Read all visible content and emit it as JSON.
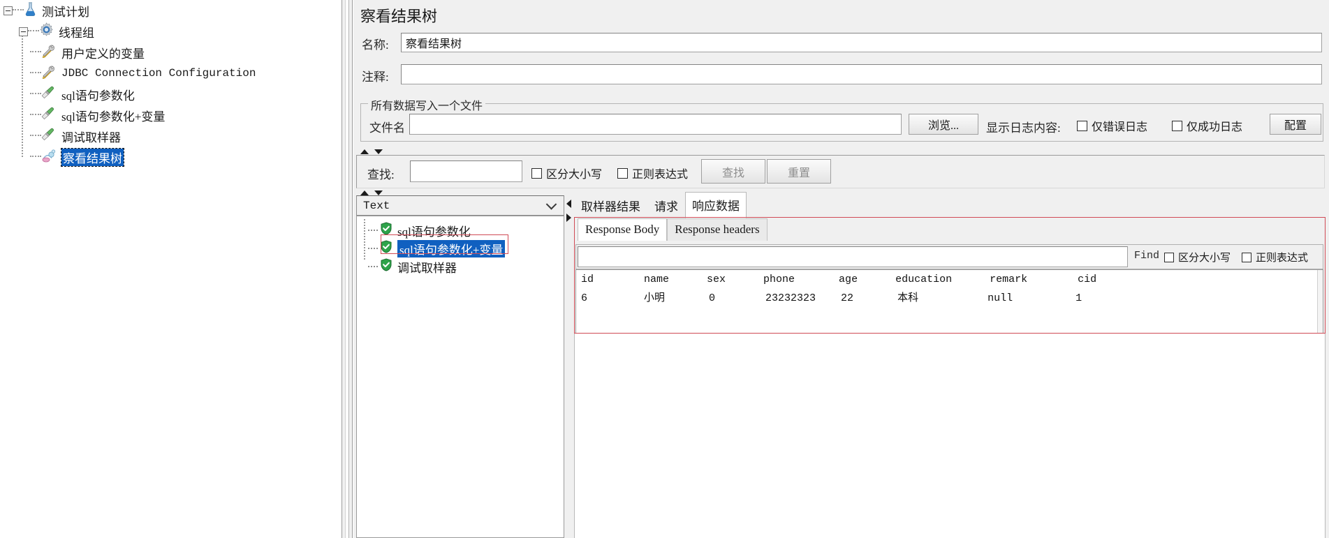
{
  "tree": {
    "items": [
      {
        "label": "测试计划",
        "icon": "flask-icon",
        "depth": 0,
        "selected": false,
        "expander": true
      },
      {
        "label": "线程组",
        "icon": "gear-icon",
        "depth": 1,
        "selected": false,
        "expander": true
      },
      {
        "label": "用户定义的变量",
        "icon": "wrench-screwdriver-icon",
        "depth": 2,
        "selected": false,
        "expander": false
      },
      {
        "label": "JDBC Connection Configuration",
        "icon": "wrench-screwdriver-icon",
        "depth": 2,
        "selected": false,
        "expander": false
      },
      {
        "label": "sql语句参数化",
        "icon": "screwdriver-icon",
        "depth": 2,
        "selected": false,
        "expander": false
      },
      {
        "label": "sql语句参数化+变量",
        "icon": "screwdriver-icon",
        "depth": 2,
        "selected": false,
        "expander": false
      },
      {
        "label": "调试取样器",
        "icon": "screwdriver-icon",
        "depth": 2,
        "selected": false,
        "expander": false
      },
      {
        "label": "察看结果树",
        "icon": "results-tree-icon",
        "depth": 2,
        "selected": true,
        "expander": false
      }
    ]
  },
  "panel": {
    "title": "察看结果树",
    "name_label": "名称:",
    "name_value": "察看结果树",
    "comment_label": "注释:",
    "comment_value": "",
    "filegroup": {
      "title": "所有数据写入一个文件",
      "filename_label": "文件名",
      "filename_value": "",
      "browse_button": "浏览...",
      "log_label": "显示日志内容:",
      "errors_only": "仅错误日志",
      "success_only": "仅成功日志",
      "configure_button": "配置"
    },
    "search": {
      "label": "查找:",
      "value": "",
      "case_sensitive": "区分大小写",
      "regex": "正则表达式",
      "find_button": "查找",
      "reset_button": "重置"
    }
  },
  "results": {
    "renderer": "Text",
    "items": [
      {
        "label": "sql语句参数化",
        "icon": "green-shield-icon",
        "selected": false
      },
      {
        "label": "sql语句参数化+变量",
        "icon": "green-shield-icon",
        "selected": true
      },
      {
        "label": "调试取样器",
        "icon": "green-shield-icon",
        "selected": false
      }
    ],
    "tabs": [
      {
        "label": "取样器结果",
        "active": false
      },
      {
        "label": "请求",
        "active": false
      },
      {
        "label": "响应数据",
        "active": true
      }
    ],
    "subtabs": [
      {
        "label": "Response Body",
        "active": true
      },
      {
        "label": "Response headers",
        "active": false
      }
    ],
    "find": {
      "value": "",
      "label": "Find",
      "case_sensitive": "区分大小写",
      "regex": "正则表达式"
    },
    "body": {
      "columns": [
        "id",
        "name",
        "sex",
        "phone",
        "age",
        "education",
        "remark",
        "cid"
      ],
      "rows": [
        [
          "6",
          "小明",
          "0",
          "23232323",
          "22",
          "本科",
          "null",
          "1"
        ]
      ],
      "header_line": "id        name      sex      phone       age      education      remark        cid",
      "row_line": "6         小明       0        23232323    22       本科           null          1"
    }
  },
  "colors": {
    "selection": "#1060c0",
    "annotation": "#d04a55",
    "panel_bg": "#f0f0f0"
  }
}
